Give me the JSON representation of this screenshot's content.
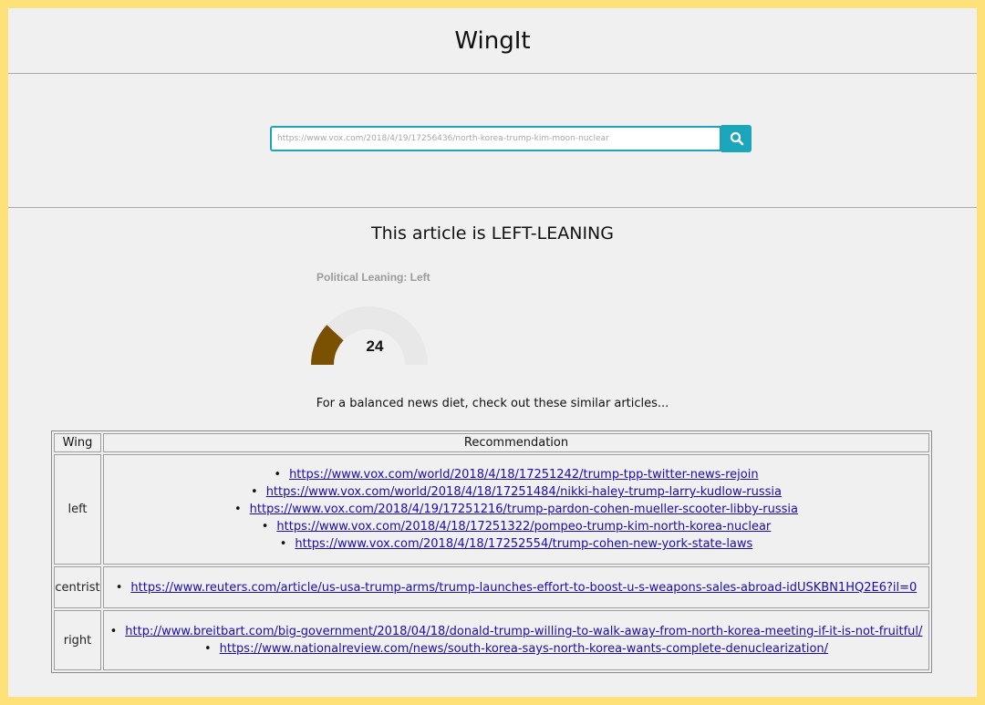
{
  "app": {
    "title": "WingIt"
  },
  "search": {
    "placeholder": "https://www.vox.com/2018/4/19/17256436/north-korea-trump-kim-moon-nuclear",
    "button_icon": "search-icon"
  },
  "result": {
    "headline": "This article is LEFT-LEANING",
    "gauge_title": "Political Leaning: Left",
    "gauge_value": "24",
    "gauge_min": 0,
    "gauge_max": 100,
    "gauge_color": "#7a5003",
    "gauge_track_color": "#e8e8e8"
  },
  "recommendations": {
    "intro": "For a balanced news diet, check out these similar articles...",
    "headers": {
      "wing": "Wing",
      "recommendation": "Recommendation"
    },
    "rows": [
      {
        "wing": "left",
        "links": [
          "https://www.vox.com/world/2018/4/18/17251242/trump-tpp-twitter-news-rejoin",
          "https://www.vox.com/world/2018/4/18/17251484/nikki-haley-trump-larry-kudlow-russia",
          "https://www.vox.com/2018/4/19/17251216/trump-pardon-cohen-mueller-scooter-libby-russia",
          "https://www.vox.com/2018/4/18/17251322/pompeo-trump-kim-north-korea-nuclear",
          "https://www.vox.com/2018/4/18/17252554/trump-cohen-new-york-state-laws"
        ]
      },
      {
        "wing": "centrist",
        "links": [
          "https://www.reuters.com/article/us-usa-trump-arms/trump-launches-effort-to-boost-u-s-weapons-sales-abroad-idUSKBN1HQ2E6?il=0"
        ]
      },
      {
        "wing": "right",
        "links": [
          "http://www.breitbart.com/big-government/2018/04/18/donald-trump-willing-to-walk-away-from-north-korea-meeting-if-it-is-not-fruitful/",
          "https://www.nationalreview.com/news/south-korea-says-north-korea-wants-complete-denuclearization/"
        ]
      }
    ]
  },
  "colors": {
    "frame_border": "#ffe17a",
    "accent": "#1ba6bd",
    "link": "#1a0dab"
  }
}
